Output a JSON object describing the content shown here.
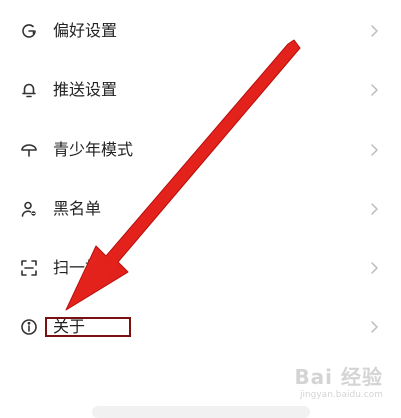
{
  "menu": {
    "items": [
      {
        "label": "偏好设置",
        "icon": "preference-icon"
      },
      {
        "label": "推送设置",
        "icon": "bell-icon"
      },
      {
        "label": "青少年模式",
        "icon": "umbrella-icon"
      },
      {
        "label": "黑名单",
        "icon": "blocked-user-icon"
      },
      {
        "label": "扫一扫",
        "icon": "scan-icon"
      },
      {
        "label": "关于",
        "icon": "info-icon"
      }
    ]
  },
  "annotation": {
    "arrow_color": "#e8201c",
    "box_color": "#7a1010"
  },
  "watermark": {
    "brand": "Bai 经验",
    "sub": "jingyan.baidu.com"
  }
}
